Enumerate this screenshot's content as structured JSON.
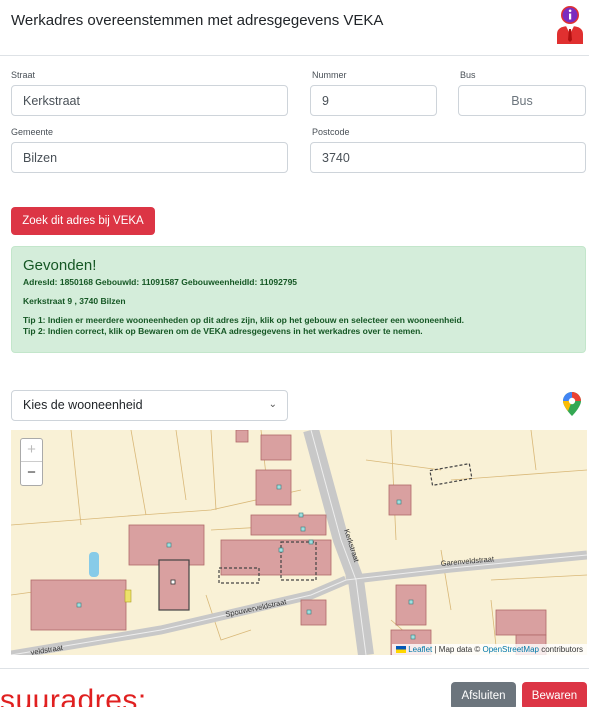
{
  "header": {
    "title": "Werkadres overeenstemmen met adresgegevens VEKA"
  },
  "form": {
    "straat": {
      "label": "Straat",
      "value": "Kerkstraat"
    },
    "nummer": {
      "label": "Nummer",
      "value": "9"
    },
    "bus": {
      "label": "Bus",
      "placeholder": "Bus"
    },
    "gemeente": {
      "label": "Gemeente",
      "value": "Bilzen"
    },
    "postcode": {
      "label": "Postcode",
      "value": "3740"
    },
    "search_button": "Zoek dit adres bij VEKA"
  },
  "result": {
    "heading": "Gevonden!",
    "ids": "AdresId: 1850168  GebouwId: 11091587  GebouweenheidId: 11092795",
    "address": "Kerkstraat 9 , 3740 Bilzen",
    "tip1": "Tip 1: Indien er meerdere wooneenheden op dit adres zijn, klik op het gebouw en selecteer een wooneenheid.",
    "tip2": "Tip 2: Indien correct, klik op Bewaren om de VEKA adresgegevens in het werkadres over te nemen."
  },
  "unit_select": {
    "selected": "Kies de wooneenheid"
  },
  "map": {
    "zoom_in": "+",
    "zoom_out": "−",
    "streets": [
      "Kerkstraat",
      "Garenveldstraat",
      "Spouwerveldstraat",
      "veldstraat"
    ],
    "attribution": {
      "leaflet": "Leaflet",
      "sep": " | Map data © ",
      "osm": "OpenStreetMap",
      "tail": " contributors"
    }
  },
  "footer": {
    "close_button": "Afsluiten",
    "save_button": "Bewaren"
  },
  "background_text": "suuradres:",
  "colors": {
    "primary_red": "#dc3545",
    "success_bg": "#d4edda",
    "success_text": "#155724",
    "secondary": "#6c757d"
  },
  "icons": {
    "header": "info-person-icon",
    "select": "chevron-down-icon",
    "map_pin": "map-pin-icon"
  }
}
